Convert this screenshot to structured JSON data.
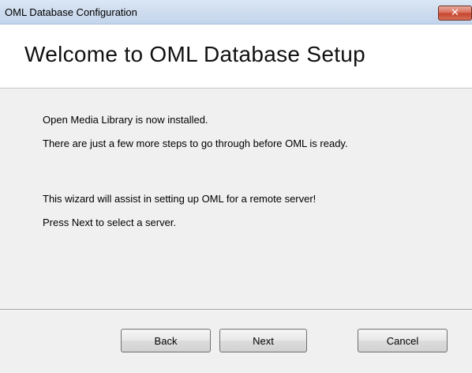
{
  "window": {
    "title": "OML Database Configuration",
    "close_glyph": "✕",
    "close_icon": "close-icon"
  },
  "header": {
    "title": "Welcome to OML Database Setup"
  },
  "body": {
    "lines": [
      "Open Media Library is now installed.",
      "There are just a few more steps to go through before OML is ready.",
      "This wizard will assist in setting up OML for a remote server!",
      "Press Next to select a server."
    ]
  },
  "buttons": {
    "back": "Back",
    "next": "Next",
    "cancel": "Cancel"
  },
  "colors": {
    "close_button": "#c5452c",
    "dialog_background": "#f0f0f0",
    "header_background": "#ffffff"
  }
}
